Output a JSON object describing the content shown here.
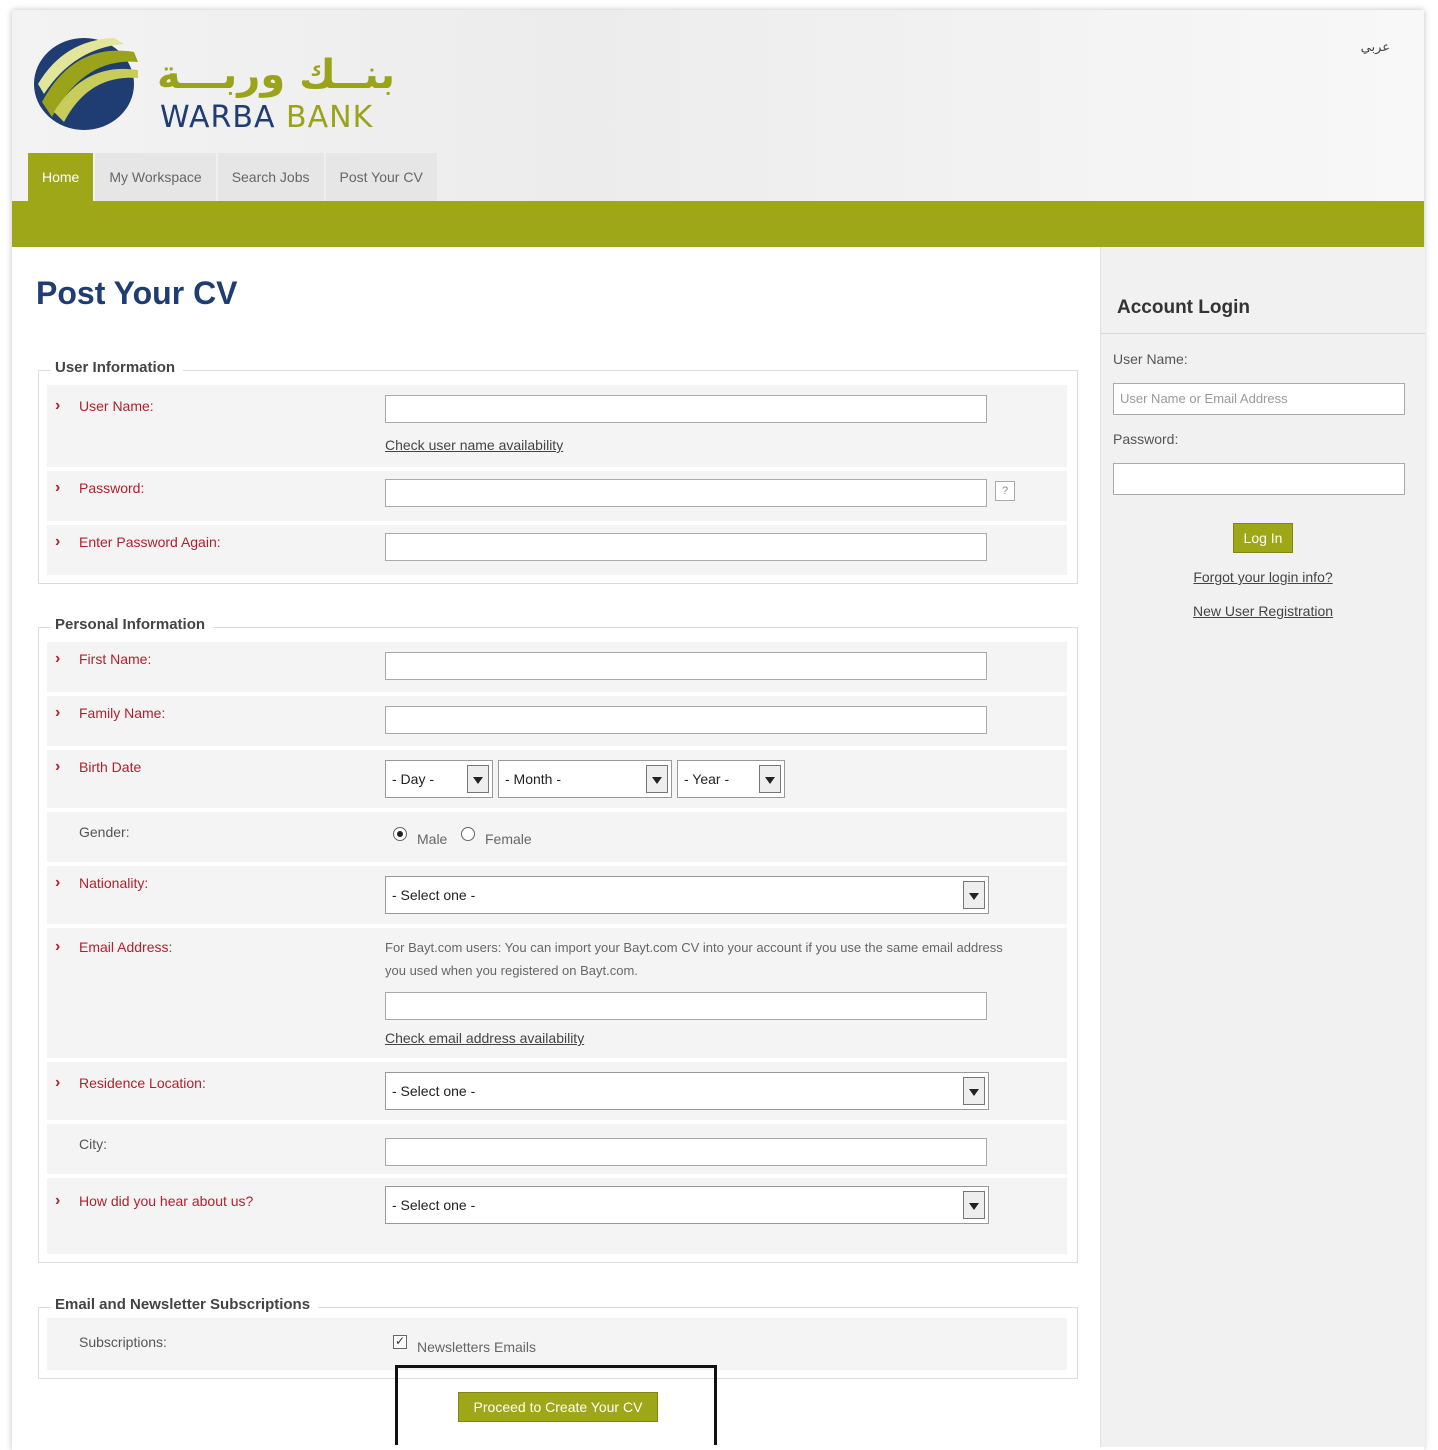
{
  "header": {
    "logo_arabic": "بنــك وربـــة",
    "logo_english_part1": "WARBA",
    "logo_english_part2": " BANK",
    "language_link": "عربي"
  },
  "tabs": [
    "Home",
    "My Workspace",
    "Search Jobs",
    "Post Your CV"
  ],
  "page_title": "Post Your CV",
  "user_info": {
    "legend": "User Information",
    "username_label": "User Name:",
    "check_username_link": "Check user name availability",
    "password_label": "Password:",
    "help_icon": "?",
    "password_again_label": "Enter Password Again:"
  },
  "personal_info": {
    "legend": "Personal Information",
    "first_name_label": "First Name:",
    "family_name_label": "Family Name:",
    "birth_date_label": "Birth Date",
    "day_placeholder": "- Day -",
    "month_placeholder": "- Month -",
    "year_placeholder": "- Year -",
    "gender_label": "Gender:",
    "gender_male": "Male",
    "gender_female": "Female",
    "nationality_label": "Nationality:",
    "select_one": "- Select one -",
    "email_label": "Email Address:",
    "email_note": "For Bayt.com users: You can import your Bayt.com CV into your account if you use the same email address you used when you registered on Bayt.com.",
    "check_email_link": "Check email address availability",
    "residence_label": "Residence Location:",
    "city_label": "City:",
    "hear_label": "How did you hear about us?"
  },
  "subscriptions": {
    "legend": "Email and Newsletter Subscriptions",
    "label": "Subscriptions:",
    "newsletter": "Newsletters Emails"
  },
  "proceed_button": "Proceed to Create Your CV",
  "sidebar": {
    "title": "Account Login",
    "username_label": "User Name:",
    "username_placeholder": "User Name or Email Address",
    "password_label": "Password:",
    "login_button": "Log In",
    "forgot_link": "Forgot your login info?",
    "register_link": "New User Registration"
  },
  "colors": {
    "brand_green": "#9ea718",
    "brand_blue": "#1f3d73",
    "required_red": "#b3202d"
  }
}
